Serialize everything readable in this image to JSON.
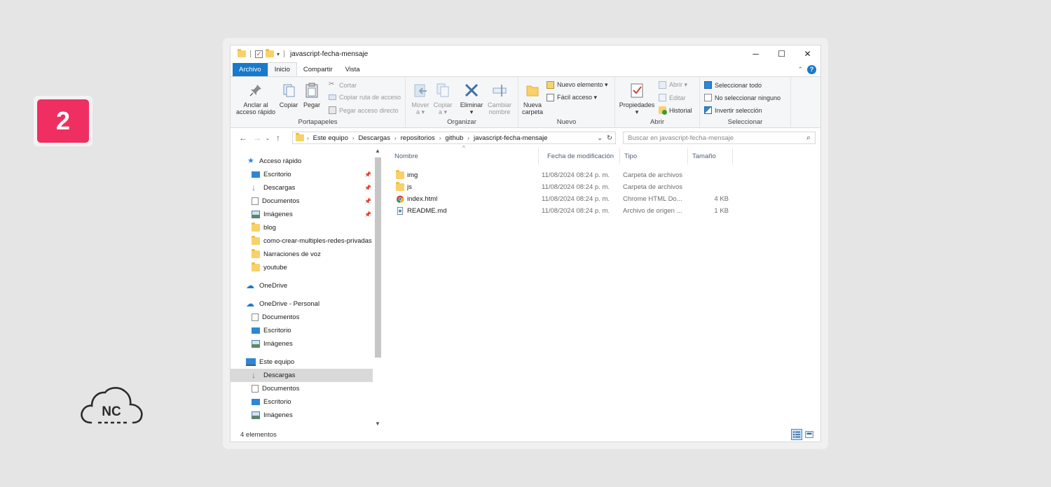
{
  "step_badge": "2",
  "logo_text": "NC",
  "window": {
    "title": "javascript-fecha-mensaje",
    "controls": [
      "─",
      "☐",
      "✕"
    ]
  },
  "tabs": [
    "Archivo",
    "Inicio",
    "Compartir",
    "Vista"
  ],
  "ribbon": {
    "portapapeles": {
      "label": "Portapapeles",
      "anclar": [
        "Anclar al",
        "acceso rápido"
      ],
      "copiar": "Copiar",
      "pegar": "Pegar",
      "cortar": "Cortar",
      "copiar_ruta": "Copiar ruta de acceso",
      "pegar_acceso": "Pegar acceso directo"
    },
    "organizar": {
      "label": "Organizar",
      "mover": [
        "Mover",
        "a ▾"
      ],
      "copiar": [
        "Copiar",
        "a ▾"
      ],
      "eliminar": [
        "Eliminar",
        "▾"
      ],
      "cambiar": [
        "Cambiar",
        "nombre"
      ]
    },
    "nuevo": {
      "label": "Nuevo",
      "nueva_carpeta": [
        "Nueva",
        "carpeta"
      ],
      "nuevo_elemento": "Nuevo elemento ▾",
      "facil_acceso": "Fácil acceso ▾"
    },
    "abrir": {
      "label": "Abrir",
      "propiedades": [
        "Propiedades",
        "▾"
      ],
      "abrir": "Abrir ▾",
      "editar": "Editar",
      "historial": "Historial"
    },
    "seleccionar": {
      "label": "Seleccionar",
      "todo": "Seleccionar todo",
      "ninguno": "No seleccionar ninguno",
      "invertir": "Invertir selección"
    }
  },
  "address": {
    "crumbs": [
      "Este equipo",
      "Descargas",
      "repositorios",
      "github",
      "javascript-fecha-mensaje"
    ],
    "search_placeholder": "Buscar en javascript-fecha-mensaje"
  },
  "nav": {
    "acceso_rapido": "Acceso rápido",
    "quick": [
      "Escritorio",
      "Descargas",
      "Documentos",
      "Imágenes",
      "blog",
      "como-crear-multiples-redes-privadas",
      "Narraciones de voz",
      "youtube"
    ],
    "onedrive": "OneDrive",
    "onedrive_personal": "OneDrive - Personal",
    "od_items": [
      "Documentos",
      "Escritorio",
      "Imágenes"
    ],
    "este_equipo": "Este equipo",
    "pc_items": [
      "Descargas",
      "Documentos",
      "Escritorio",
      "Imágenes"
    ]
  },
  "columns": [
    "Nombre",
    "Fecha de modificación",
    "Tipo",
    "Tamaño"
  ],
  "files": [
    {
      "name": "img",
      "date": "11/08/2024 08:24 p. m.",
      "type": "Carpeta de archivos",
      "size": ""
    },
    {
      "name": "js",
      "date": "11/08/2024 08:24 p. m.",
      "type": "Carpeta de archivos",
      "size": ""
    },
    {
      "name": "index.html",
      "date": "11/08/2024 08:24 p. m.",
      "type": "Chrome HTML Do...",
      "size": "4 KB"
    },
    {
      "name": "README.md",
      "date": "11/08/2024 08:24 p. m.",
      "type": "Archivo de origen ...",
      "size": "1 KB"
    }
  ],
  "status": "4 elementos",
  "colors": {
    "accent": "#1979ca",
    "badge": "#ef2f61",
    "folder": "#f8d169"
  }
}
